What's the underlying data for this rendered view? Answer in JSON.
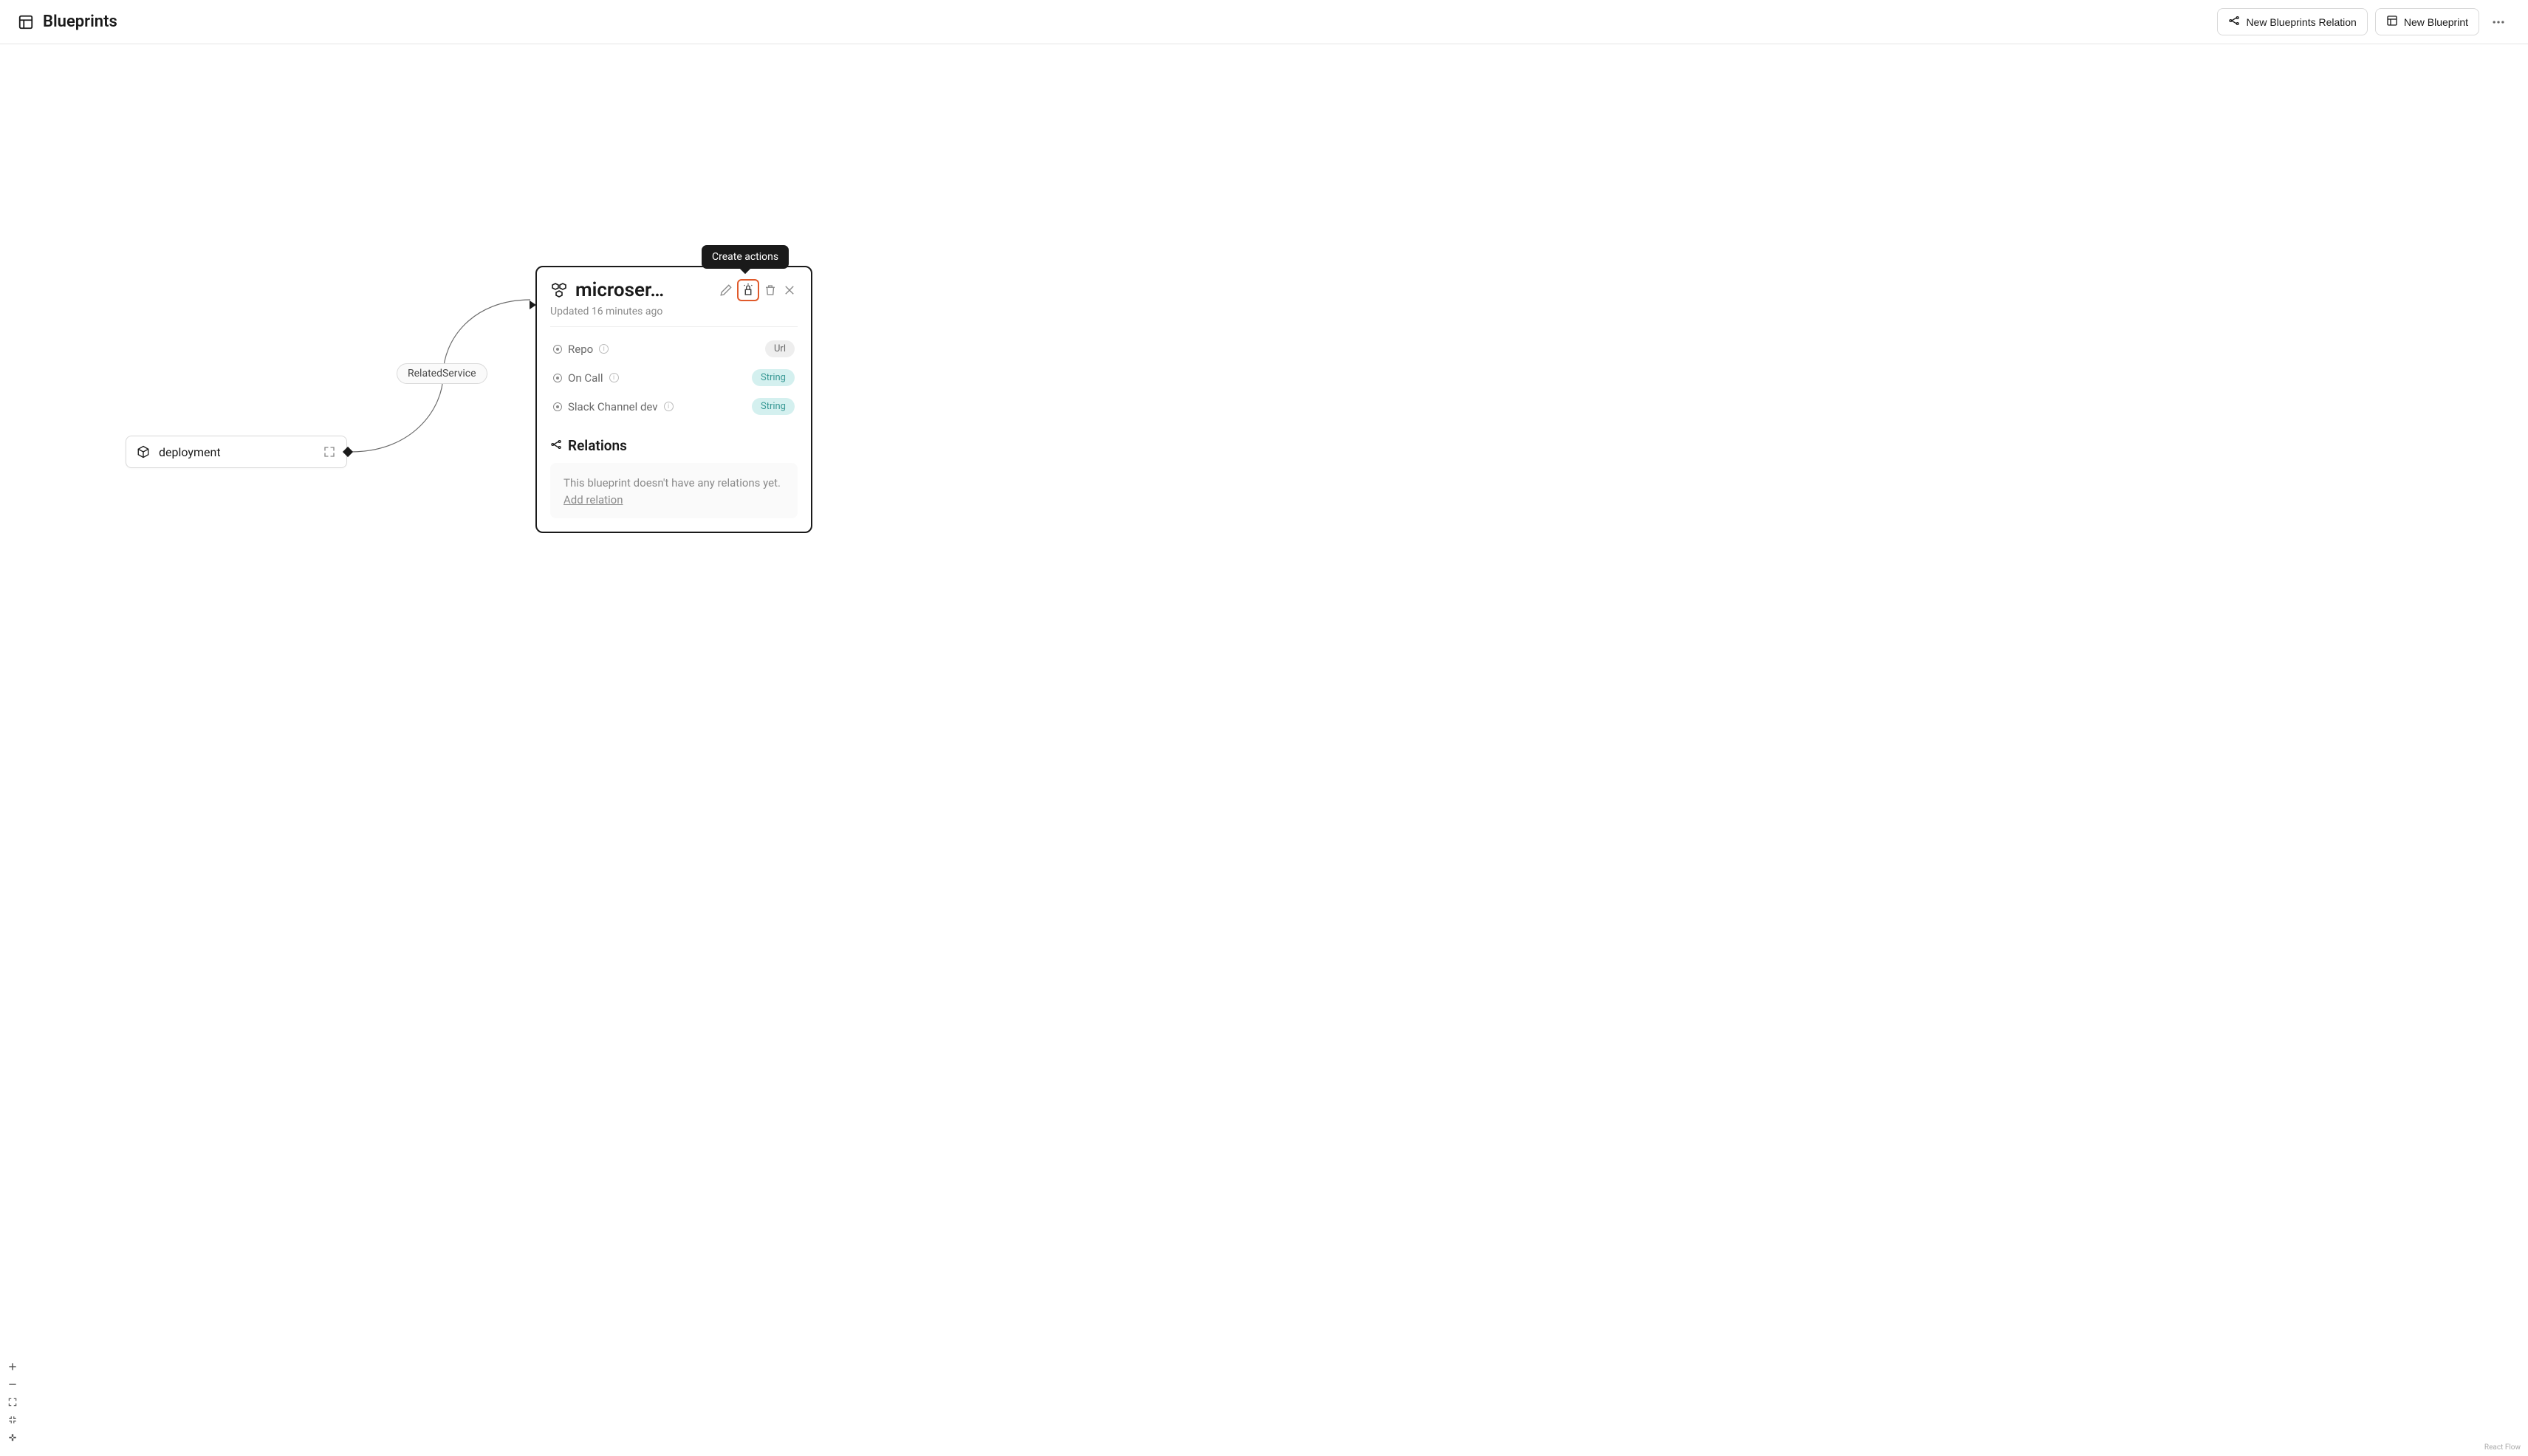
{
  "header": {
    "title": "Blueprints",
    "new_relation_label": "New Blueprints Relation",
    "new_blueprint_label": "New Blueprint"
  },
  "deployment_node": {
    "label": "deployment"
  },
  "edge": {
    "label": "RelatedService"
  },
  "tooltip": {
    "label": "Create actions"
  },
  "card": {
    "title": "microser…",
    "subtitle": "Updated 16 minutes ago",
    "properties": [
      {
        "name": "Repo",
        "type": "Url",
        "type_class": "url"
      },
      {
        "name": "On Call",
        "type": "String",
        "type_class": "string"
      },
      {
        "name": "Slack Channel dev",
        "type": "String",
        "type_class": "string"
      }
    ],
    "relations_title": "Relations",
    "relations_empty_text": "This blueprint doesn't have any relations yet.",
    "add_relation_label": "Add relation"
  },
  "attribution": "React Flow"
}
